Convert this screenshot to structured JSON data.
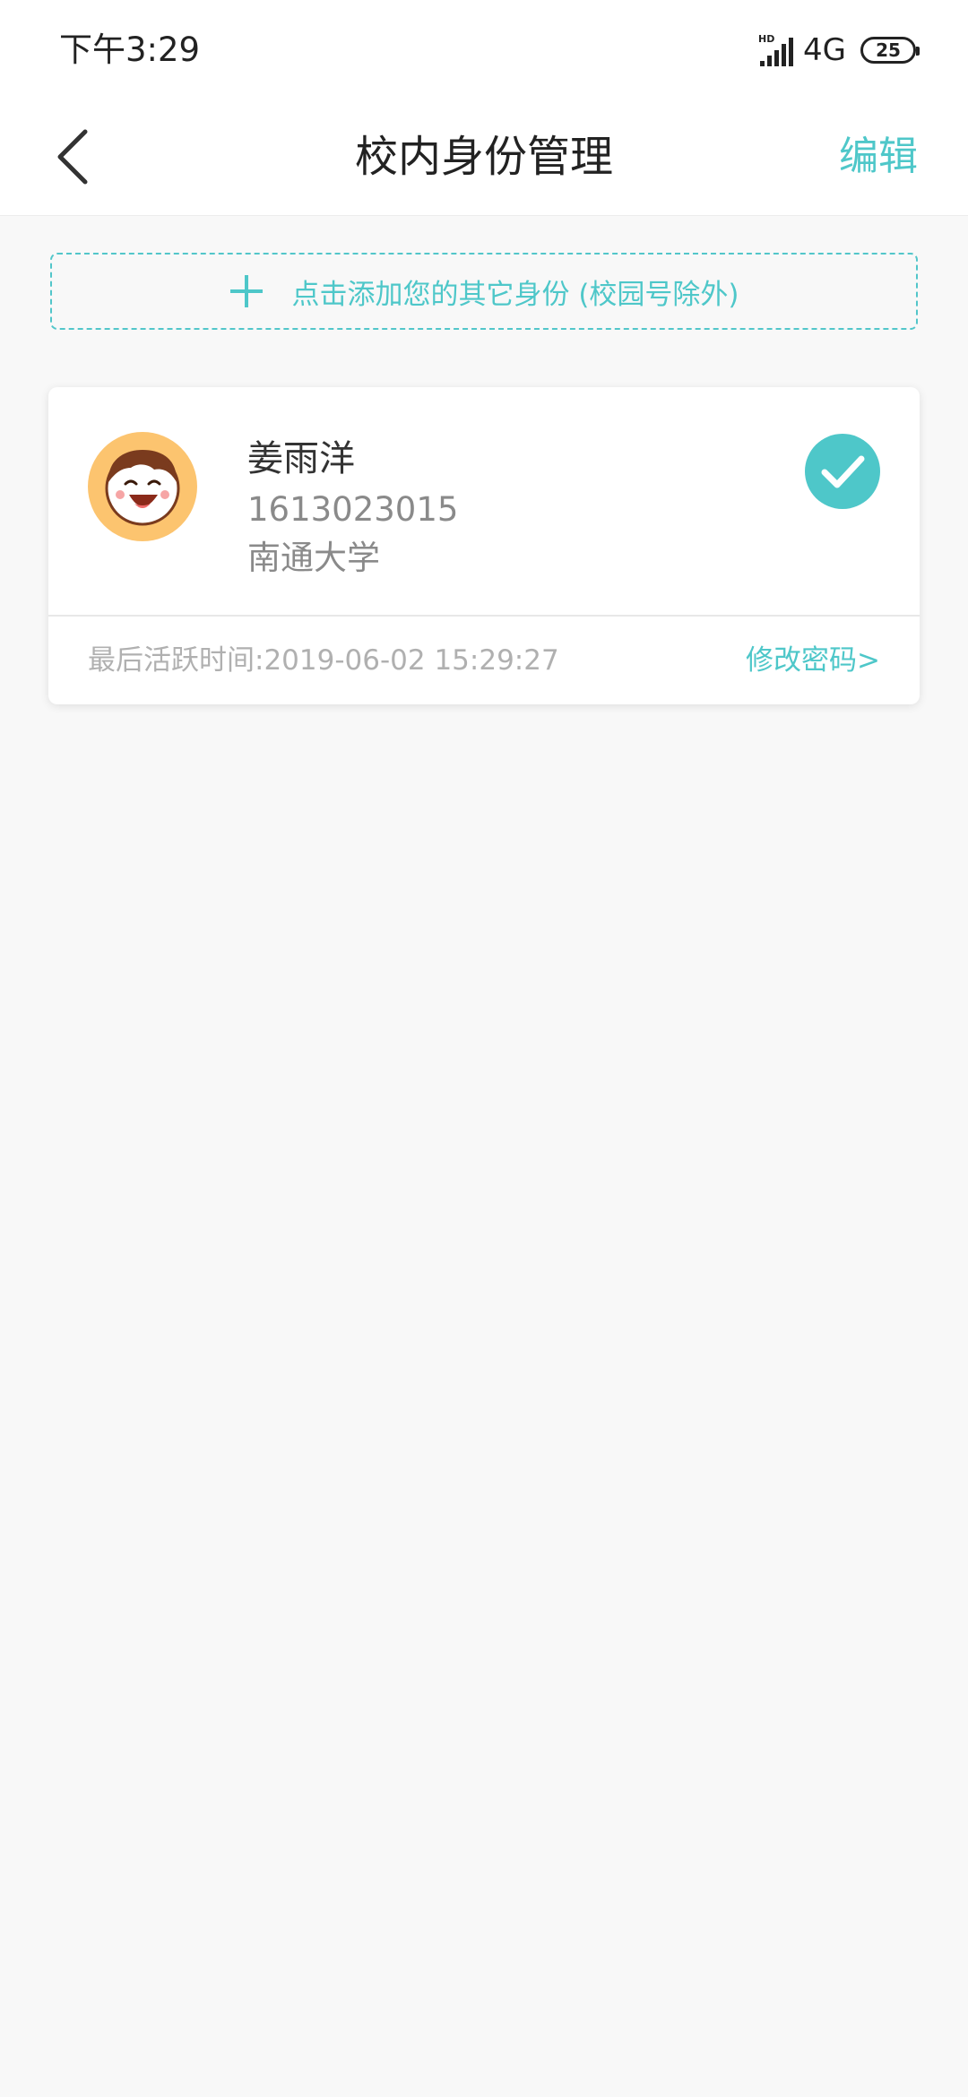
{
  "status_bar": {
    "time": "下午3:29",
    "network": "4G",
    "battery": "25"
  },
  "nav": {
    "title": "校内身份管理",
    "edit_label": "编辑"
  },
  "add_identity": {
    "label": "点击添加您的其它身份 (校园号除外)"
  },
  "identity_card": {
    "name": "姜雨洋",
    "student_id": "1613023015",
    "school": "南通大学",
    "last_active": "最后活跃时间:2019-06-02 15:29:27",
    "change_password_label": "修改密码>",
    "selected": true
  },
  "colors": {
    "accent": "#4ec7c9",
    "background": "#f8f8f8",
    "avatar_bg": "#fcc46f"
  },
  "icons": {
    "back": "chevron-left-icon",
    "add": "plus-icon",
    "selected": "check-circle-icon",
    "avatar": "smiley-face-avatar"
  }
}
